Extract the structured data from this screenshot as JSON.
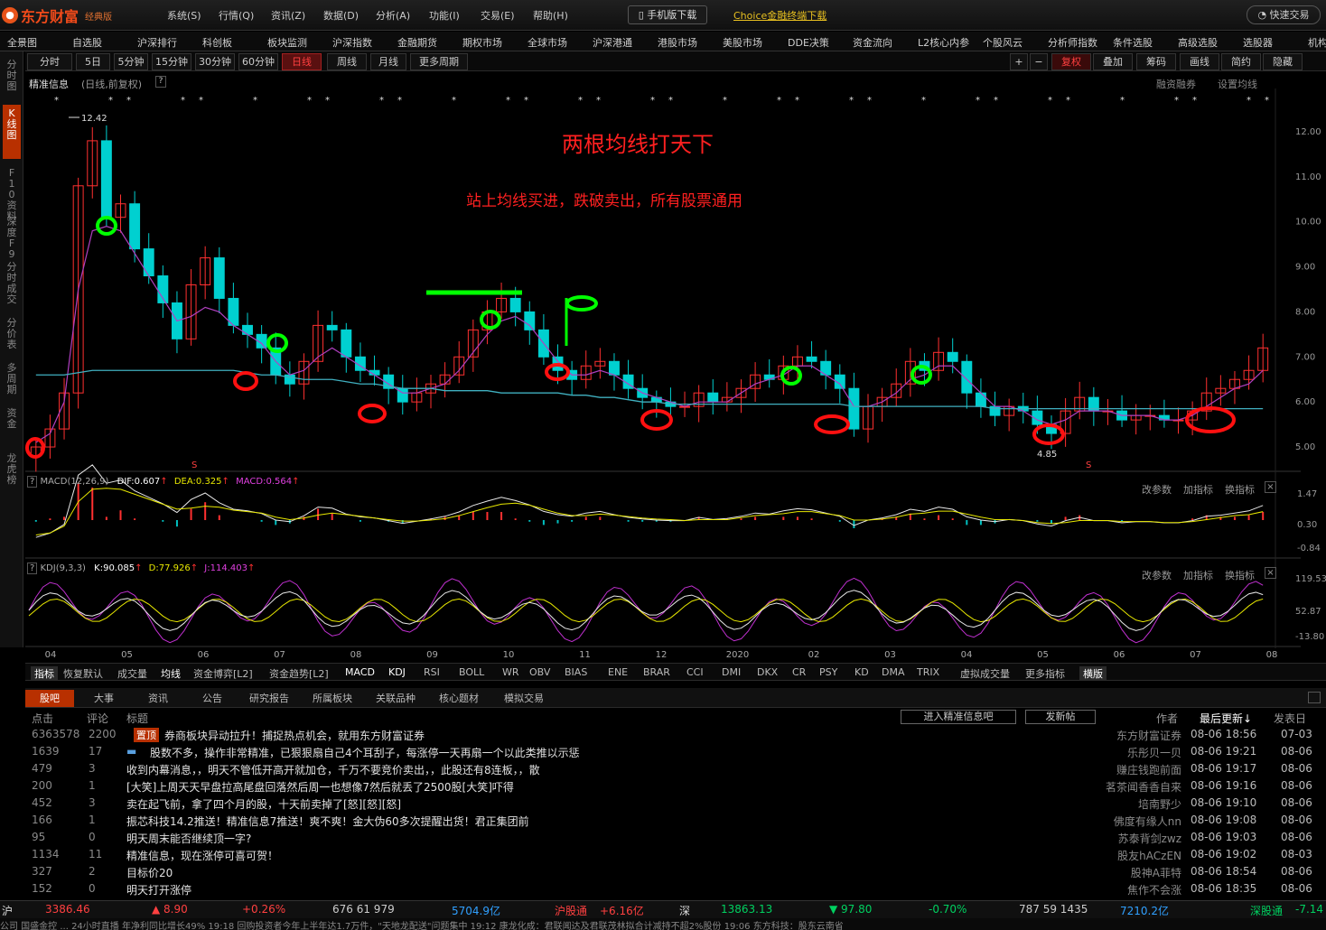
{
  "app": {
    "logo_text": "东方财富",
    "edition": "经典版",
    "phone_download": "手机版下载",
    "choice_download": "Choice金融终端下载",
    "quick_trade": "快速交易"
  },
  "menus": [
    "系统(S)",
    "行情(Q)",
    "资讯(Z)",
    "数据(D)",
    "分析(A)",
    "功能(I)",
    "交易(E)",
    "帮助(H)"
  ],
  "nav": [
    "全景图",
    "自选股",
    "沪深排行",
    "科创板",
    "板块监测",
    "沪深指数",
    "金融期货",
    "期权市场",
    "全球市场",
    "沪深港通",
    "港股市场",
    "美股市场",
    "DDE决策",
    "资金流向",
    "L2核心内参",
    "个股风云",
    "分析师指数",
    "条件选股",
    "高级选股",
    "选股器",
    "机构"
  ],
  "periods": [
    "分时",
    "5日",
    "5分钟",
    "15分钟",
    "30分钟",
    "60分钟",
    "日线",
    "周线",
    "月线",
    "更多周期"
  ],
  "active_period": "日线",
  "right_tools": [
    "+",
    "−",
    "复权",
    "叠加",
    "筹码",
    "画线",
    "简约",
    "隐藏"
  ],
  "left_tabs": [
    "分时图",
    "K线图",
    "F10资料",
    "深度F9",
    "分时成交",
    "分价表",
    "多周期",
    "资金",
    "龙虎榜"
  ],
  "info": {
    "label": "精准信息",
    "mode": "(日线,前复权)",
    "margin": "融资融券",
    "set_ma": "设置均线"
  },
  "annotations": {
    "title": "两根均线打天下",
    "subtitle": "站上均线买进，跌破卖出，所有股票通用"
  },
  "price_axis": [
    "12.00",
    "11.00",
    "10.00",
    "9.00",
    "8.00",
    "7.00",
    "6.00",
    "5.00"
  ],
  "markers": {
    "high": "12.42",
    "low": "4.85",
    "s": "S"
  },
  "macd": {
    "label": "MACD(12,26,9)",
    "dif": "DIF:0.607",
    "dea": "DEA:0.325",
    "macd": "MACD:0.564",
    "axis": [
      "1.47",
      "0.30",
      "-0.84"
    ]
  },
  "kdj": {
    "label": "KDJ(9,3,3)",
    "k": "K:90.085",
    "d": "D:77.926",
    "j": "J:114.403",
    "axis": [
      "119.53",
      "52.87",
      "-13.80"
    ]
  },
  "panel_btns": [
    "改参数",
    "加指标",
    "换指标"
  ],
  "time_axis": [
    "04",
    "05",
    "06",
    "07",
    "08",
    "09",
    "10",
    "11",
    "12",
    "2020",
    "02",
    "03",
    "04",
    "05",
    "06",
    "07",
    "08"
  ],
  "indicators": [
    "指标",
    "恢复默认",
    "成交量",
    "均线",
    "资金博弈[L2]",
    "资金趋势[L2]",
    "MACD",
    "KDJ",
    "RSI",
    "BOLL",
    "WR",
    "OBV",
    "BIAS",
    "ENE",
    "BRAR",
    "CCI",
    "DMI",
    "DKX",
    "CR",
    "PSY",
    "KD",
    "DMA",
    "TRIX",
    "虚拟成交量",
    "更多指标",
    "横版"
  ],
  "tabs": [
    "股吧",
    "大事",
    "资讯",
    "公告",
    "研究报告",
    "所属板块",
    "关联品种",
    "核心题材",
    "模拟交易"
  ],
  "table_head": {
    "clicks": "点击",
    "comments": "评论",
    "title": "标题",
    "author": "作者",
    "updated": "最后更新↓",
    "posted": "发表日",
    "enter_btn": "进入精准信息吧",
    "post_btn": "发新帖"
  },
  "posts": [
    {
      "clicks": "6363578",
      "comments": "2200",
      "title": "券商板块异动拉升！捕捉热点机会，就用东方财富证券",
      "author": "东方财富证券",
      "updated": "08-06 18:56",
      "posted": "07-03",
      "ad": "置顶"
    },
    {
      "clicks": "1639",
      "comments": "17",
      "title": "股数不多，操作非常精准，已狠狠扇自己4个耳刮子，每涨停一天再扇一个以此类推以示惩",
      "author": "乐彤贝一贝",
      "updated": "08-06 19:21",
      "posted": "08-06"
    },
    {
      "clicks": "479",
      "comments": "3",
      "title": "收到内幕消息，，明天不管低开高开就加仓，千万不要竞价卖出，，此股还有8连板，，散",
      "author": "赚庄钱跑前面",
      "updated": "08-06 19:17",
      "posted": "08-06"
    },
    {
      "clicks": "200",
      "comments": "1",
      "title": "[大笑]上周天天早盘拉高尾盘回落然后周一也想像7然后就丢了2500股[大笑]吓得",
      "author": "茗茶闻香香自来",
      "updated": "08-06 19:16",
      "posted": "08-06"
    },
    {
      "clicks": "452",
      "comments": "3",
      "title": "卖在起飞前，拿了四个月的股，十天前卖掉了[怒][怒][怒]",
      "author": "培南野少",
      "updated": "08-06 19:10",
      "posted": "08-06"
    },
    {
      "clicks": "166",
      "comments": "1",
      "title": "振芯科技14.2推送！精准信息7推送！爽不爽！金大伪60多次提醒出货！君正集团前",
      "author": "佛度有缘人nn",
      "updated": "08-06 19:08",
      "posted": "08-06"
    },
    {
      "clicks": "95",
      "comments": "0",
      "title": "明天周末能否继续顶一字?",
      "author": "苏泰背剑zwz",
      "updated": "08-06 19:03",
      "posted": "08-06"
    },
    {
      "clicks": "1134",
      "comments": "11",
      "title": "精准信息，现在涨停可喜可贺！",
      "author": "股友hACzEN",
      "updated": "08-06 19:02",
      "posted": "08-03"
    },
    {
      "clicks": "327",
      "comments": "2",
      "title": "目标价20",
      "author": "股神A菲特",
      "updated": "08-06 18:54",
      "posted": "08-06"
    },
    {
      "clicks": "152",
      "comments": "0",
      "title": "明天打开涨停",
      "author": "焦作不会涨",
      "updated": "08-06 18:35",
      "posted": "08-06"
    }
  ],
  "status": {
    "sh": "沪",
    "sh_idx": "3386.46",
    "sh_chg": "▲ 8.90",
    "sh_pct": "+0.26%",
    "sh_cnt": "676 61 979",
    "sh_amt": "5704.9亿",
    "hgt": "沪股通",
    "hgt_val": "+6.16亿",
    "sz": "深",
    "sz_idx": "13863.13",
    "sz_chg": "▼ 97.80",
    "sz_pct": "-0.70%",
    "sz_cnt": "787 59 1435",
    "sz_amt": "7210.2亿",
    "sgt": "深股通",
    "sgt_val": "-7.14"
  },
  "news": "公司 国盛金控 ... 24小时直播 年净利同比增长49% 19:18 回购投资者今年上半年达1.7万件，\"天地龙配送\"问题集中 19:12 康龙化成：君联闻达及君联茂林拟合计减持不超2%股份 19:06 东方科技：股东云南省",
  "colors": {
    "brand": "#f04a1a",
    "up": "#ff3030",
    "down": "#00d0d0",
    "ma_short": "#b040c0",
    "ma_long": "#40b0c0",
    "green_mark": "#00ff00",
    "red_mark": "#ff1010"
  },
  "chart_data": {
    "type": "candlestick",
    "title": "两根均线打天下",
    "ylim": [
      4.7,
      12.6
    ],
    "series": [
      {
        "name": "close",
        "values": [
          5.0,
          5.4,
          6.2,
          10.8,
          11.8,
          10.1,
          10.4,
          9.4,
          8.8,
          8.2,
          7.4,
          8.6,
          9.2,
          8.3,
          7.7,
          7.5,
          7.2,
          6.6,
          6.4,
          6.9,
          7.7,
          7.6,
          7.0,
          6.7,
          6.6,
          6.3,
          6.0,
          6.2,
          6.4,
          6.6,
          7.0,
          7.6,
          8.0,
          8.3,
          8.0,
          7.6,
          7.0,
          6.7,
          6.5,
          6.8,
          6.9,
          6.6,
          6.3,
          6.1,
          6.0,
          5.9,
          5.9,
          6.2,
          6.0,
          6.1,
          6.3,
          6.6,
          6.5,
          6.8,
          7.0,
          6.9,
          6.6,
          6.3,
          5.4,
          5.9,
          6.1,
          6.4,
          6.9,
          6.7,
          7.1,
          6.9,
          6.2,
          5.9,
          5.7,
          5.9,
          5.8,
          5.5,
          5.3,
          5.8,
          6.1,
          5.8,
          5.8,
          5.6,
          5.7,
          5.7,
          5.6,
          5.6,
          5.8,
          6.2,
          6.3,
          6.5,
          6.7,
          7.2
        ]
      },
      {
        "name": "ma_short",
        "values": [
          5.1,
          5.3,
          6.0,
          8.5,
          9.8,
          9.9,
          9.8,
          9.3,
          8.8,
          8.3,
          7.8,
          7.9,
          8.1,
          8.0,
          7.7,
          7.5,
          7.3,
          6.9,
          6.6,
          6.7,
          7.0,
          7.2,
          7.0,
          6.8,
          6.6,
          6.4,
          6.2,
          6.2,
          6.3,
          6.4,
          6.7,
          7.1,
          7.5,
          7.8,
          7.9,
          7.7,
          7.3,
          6.9,
          6.6,
          6.6,
          6.7,
          6.6,
          6.4,
          6.2,
          6.1,
          6.0,
          5.9,
          6.0,
          6.0,
          6.0,
          6.2,
          6.4,
          6.5,
          6.6,
          6.8,
          6.8,
          6.6,
          6.4,
          5.9,
          5.9,
          6.0,
          6.2,
          6.5,
          6.6,
          6.8,
          6.8,
          6.5,
          6.2,
          5.9,
          5.9,
          5.8,
          5.6,
          5.5,
          5.6,
          5.8,
          5.8,
          5.8,
          5.7,
          5.7,
          5.7,
          5.6,
          5.6,
          5.7,
          5.9,
          6.1,
          6.3,
          6.4,
          6.7
        ]
      },
      {
        "name": "ma_long",
        "values": [
          6.6,
          6.6,
          6.6,
          6.65,
          6.7,
          6.7,
          6.7,
          6.7,
          6.7,
          6.7,
          6.7,
          6.7,
          6.7,
          6.7,
          6.7,
          6.65,
          6.6,
          6.6,
          6.55,
          6.5,
          6.5,
          6.5,
          6.45,
          6.4,
          6.4,
          6.35,
          6.3,
          6.3,
          6.3,
          6.25,
          6.25,
          6.25,
          6.25,
          6.2,
          6.2,
          6.2,
          6.2,
          6.2,
          6.15,
          6.15,
          6.1,
          6.1,
          6.05,
          6.0,
          6.0,
          5.95,
          5.95,
          5.95,
          5.95,
          5.95,
          5.95,
          5.95,
          5.95,
          5.95,
          5.95,
          5.95,
          5.95,
          5.95,
          5.9,
          5.9,
          5.9,
          5.9,
          5.9,
          5.9,
          5.9,
          5.9,
          5.9,
          5.9,
          5.85,
          5.85,
          5.85,
          5.85,
          5.85,
          5.85,
          5.85,
          5.85,
          5.85,
          5.85,
          5.85,
          5.85,
          5.85,
          5.85,
          5.85,
          5.85,
          5.85,
          5.85,
          5.85,
          5.85
        ]
      }
    ]
  }
}
